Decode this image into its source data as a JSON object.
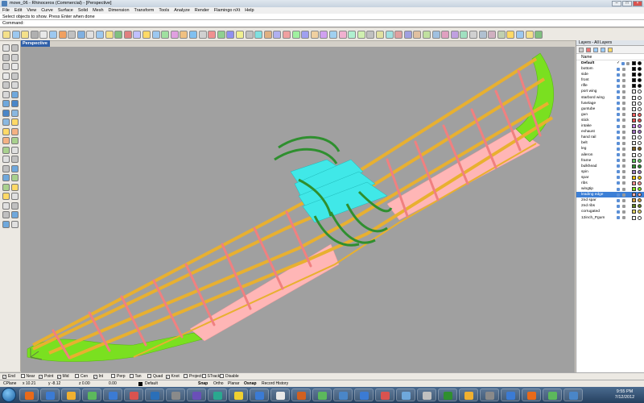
{
  "window": {
    "title": "move_06 - Rhinoceros (Commercial) - [Perspective]"
  },
  "menu": [
    "File",
    "Edit",
    "View",
    "Curve",
    "Surface",
    "Solid",
    "Mesh",
    "Dimension",
    "Transform",
    "Tools",
    "Analyze",
    "Render",
    "Flamingo nXt",
    "Help"
  ],
  "command": {
    "history": "Select objects to show. Press Enter when done",
    "prompt": "Command:"
  },
  "viewport": {
    "tab": "Perspective"
  },
  "layers_panel": {
    "title": "Layers - All Layers",
    "column_name": "Name",
    "layers": [
      {
        "name": "Default",
        "current": true,
        "color": "#000000"
      },
      {
        "name": "bottom",
        "color": "#000000"
      },
      {
        "name": "side",
        "color": "#000000"
      },
      {
        "name": "front",
        "color": "#000000"
      },
      {
        "name": "rifle",
        "color": "#000000"
      },
      {
        "name": "port wing",
        "color": "#ffffff"
      },
      {
        "name": "starbord wing",
        "color": "#ffffff"
      },
      {
        "name": "fuselage",
        "color": "#ffffff"
      },
      {
        "name": "guntube",
        "color": "#ffffff"
      },
      {
        "name": "gun",
        "color": "#ff6060"
      },
      {
        "name": "stick",
        "color": "#e05050"
      },
      {
        "name": "intake",
        "color": "#c080e0"
      },
      {
        "name": "exhaust",
        "color": "#a070c0"
      },
      {
        "name": "hand rail",
        "color": "#ffffff"
      },
      {
        "name": "belt",
        "color": "#ffffff"
      },
      {
        "name": "leg",
        "color": "#806020"
      },
      {
        "name": "aileron",
        "color": "#ffffff"
      },
      {
        "name": "frame",
        "color": "#60c060"
      },
      {
        "name": "bulkhead",
        "color": "#2f8f2f"
      },
      {
        "name": "spin",
        "color": "#a080c0"
      },
      {
        "name": "spar",
        "color": "#f0c000"
      },
      {
        "name": "ribs",
        "color": "#ff9090"
      },
      {
        "name": "wingtip",
        "color": "#80e020"
      },
      {
        "name": "leading edge",
        "color": "#ffb0b0",
        "selected": true
      },
      {
        "name": "2nd spar",
        "color": "#d0a040"
      },
      {
        "name": "2nd ribs",
        "color": "#608020"
      },
      {
        "name": "corrugated",
        "color": "#e0d060"
      },
      {
        "name": "12inch_Pgum",
        "color": "#ffffff"
      }
    ]
  },
  "osnap": {
    "items": [
      {
        "label": "End",
        "checked": true
      },
      {
        "label": "Near",
        "checked": false
      },
      {
        "label": "Point",
        "checked": true
      },
      {
        "label": "Mid",
        "checked": true
      },
      {
        "label": "Cen",
        "checked": false
      },
      {
        "label": "Int",
        "checked": true
      },
      {
        "label": "Perp",
        "checked": false
      },
      {
        "label": "Tan",
        "checked": false
      },
      {
        "label": "Quad",
        "checked": false
      },
      {
        "label": "Knot",
        "checked": true
      },
      {
        "label": "Project",
        "checked": false
      },
      {
        "label": "STrack",
        "checked": false
      },
      {
        "label": "Disable",
        "checked": false
      }
    ]
  },
  "status": {
    "cplane": "CPlane",
    "x": "x 10.21",
    "y": "y -8.12",
    "z": "z 0.00",
    "value": "0.00",
    "layer": "Default",
    "snap": "Snap",
    "ortho": "Ortho",
    "planar": "Planar",
    "osnap": "Osnap",
    "record": "Record History"
  },
  "taskbar": {
    "time": "9:55 PM",
    "date": "7/12/2012"
  },
  "colors": {
    "viewport_bg": "#a0a0a0",
    "spar": "#e8b030",
    "rib": "#f08080",
    "leading_edge": "#ffb6b6",
    "wingtip": "#7ae020",
    "bulkhead": "#2f8f2f",
    "frame": "#40e8e8"
  }
}
